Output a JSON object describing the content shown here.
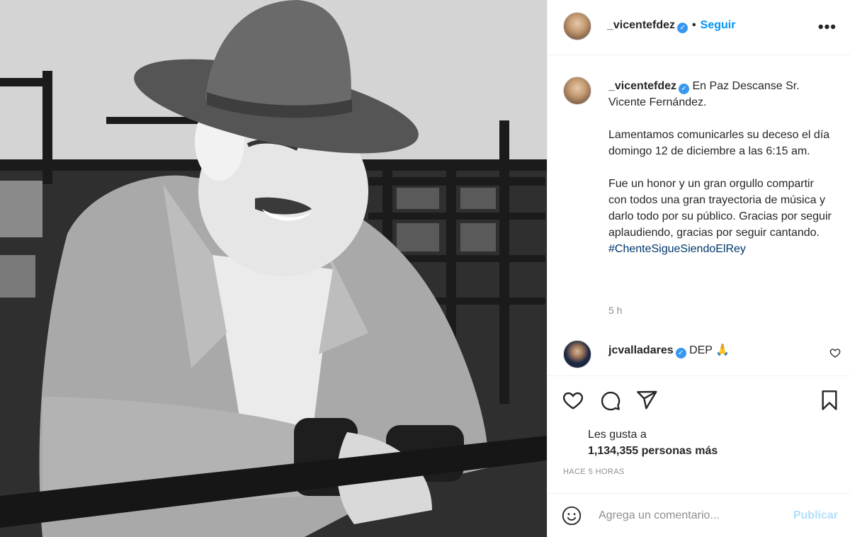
{
  "post": {
    "author": "_vicentefdez",
    "follow_label": "Seguir",
    "dot": "•",
    "more_label": "•••",
    "verified_mark": "✓",
    "caption": {
      "first_line": "En Paz Descanse Sr. Vicente Fernández.",
      "paragraph2": "Lamentamos comunicarles su deceso el día domingo 12 de diciembre a las 6:15 am.",
      "paragraph3": "Fue un honor y un gran orgullo compartir con todos una gran trayectoria de música y darlo todo por su público. Gracias por seguir aplaudiendo, gracias por seguir cantando.",
      "hashtag": "#ChenteSigueSiendoElRey"
    },
    "caption_time": "5 h"
  },
  "comment": {
    "user": "jcvalladares",
    "text": "DEP",
    "emoji": "🙏"
  },
  "likes": {
    "line1": "Les gusta a",
    "line2": "1,134,355 personas más"
  },
  "timestamp": "HACE 5 HORAS",
  "add_comment": {
    "placeholder": "Agrega un comentario...",
    "publish_label": "Publicar"
  },
  "icons": {
    "like": "heart-icon",
    "comment": "comment-icon",
    "share": "paper-plane-icon",
    "save": "bookmark-icon",
    "emoji": "smiley-icon",
    "options": "more-icon"
  },
  "colors": {
    "accent": "#0095f6",
    "verified": "#3897f0",
    "hashtag": "#00376b",
    "muted": "#8e8e8e",
    "publish_disabled": "#b2dffc"
  }
}
